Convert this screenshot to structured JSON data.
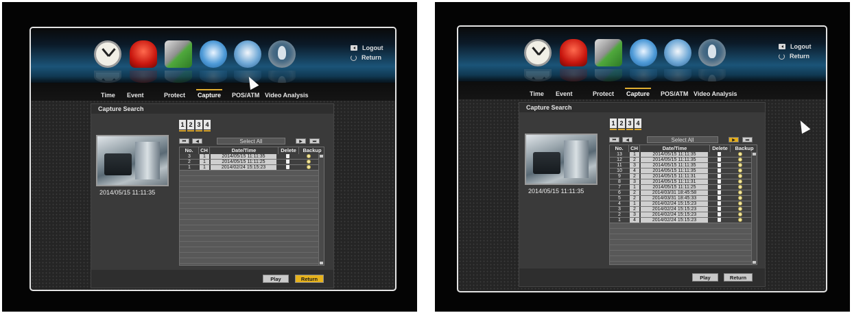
{
  "menu": {
    "tabs": [
      {
        "label": "Time",
        "icon": "clock-icon"
      },
      {
        "label": "Event",
        "icon": "siren-icon"
      },
      {
        "label": "Protect",
        "icon": "shield-icon"
      },
      {
        "label": "Capture",
        "icon": "camera-icon"
      },
      {
        "label": "POS/ATM",
        "icon": "register-icon"
      },
      {
        "label": "Video Analysis",
        "icon": "analysis-icon"
      }
    ],
    "logout": "Logout",
    "return": "Return"
  },
  "left": {
    "title": "Capture Search",
    "pages": [
      "1",
      "2",
      "3",
      "4"
    ],
    "select_all": "Select All",
    "nav": [
      "⏮",
      "◀",
      "▶",
      "⏭"
    ],
    "columns": [
      "No.",
      "CH",
      "Date/Time",
      "Delete",
      "Backup"
    ],
    "rows": [
      {
        "no": "3",
        "ch": "1",
        "datetime": "2014/05/15 11:11:35"
      },
      {
        "no": "2",
        "ch": "1",
        "datetime": "2014/05/15 11:11:25"
      },
      {
        "no": "1",
        "ch": "1",
        "datetime": "2014/02/24 15:15:23"
      }
    ],
    "thumb_time": "2014/05/15 11:11:35",
    "play": "Play",
    "return_btn": "Return"
  },
  "right": {
    "title": "Capture Search",
    "pages": [
      "1",
      "2",
      "3",
      "4"
    ],
    "select_all": "Select All",
    "nav": [
      "⏮",
      "◀",
      "▶",
      "⏭"
    ],
    "columns": [
      "No.",
      "CH",
      "Date/Time",
      "Delete",
      "Backup"
    ],
    "rows": [
      {
        "no": "13",
        "ch": "1",
        "datetime": "2014/05/15 11:11:35"
      },
      {
        "no": "12",
        "ch": "2",
        "datetime": "2014/05/15 11:11:35"
      },
      {
        "no": "11",
        "ch": "3",
        "datetime": "2014/05/15 11:11:35"
      },
      {
        "no": "10",
        "ch": "4",
        "datetime": "2014/05/15 11:11:35"
      },
      {
        "no": "9",
        "ch": "2",
        "datetime": "2014/05/15 11:11:31"
      },
      {
        "no": "8",
        "ch": "3",
        "datetime": "2014/05/15 11:11:31"
      },
      {
        "no": "7",
        "ch": "1",
        "datetime": "2014/05/15 11:11:25"
      },
      {
        "no": "6",
        "ch": "2",
        "datetime": "2014/03/31 18:45:58"
      },
      {
        "no": "5",
        "ch": "2",
        "datetime": "2014/03/31 18:45:33"
      },
      {
        "no": "4",
        "ch": "1",
        "datetime": "2014/02/24 15:15:23"
      },
      {
        "no": "3",
        "ch": "2",
        "datetime": "2014/02/24 15:15:23"
      },
      {
        "no": "2",
        "ch": "3",
        "datetime": "2014/02/24 15:15:23"
      },
      {
        "no": "1",
        "ch": "4",
        "datetime": "2014/02/24 15:15:23"
      }
    ],
    "thumb_time": "2014/05/15 11:11:35",
    "play": "Play",
    "return_btn": "Return"
  }
}
